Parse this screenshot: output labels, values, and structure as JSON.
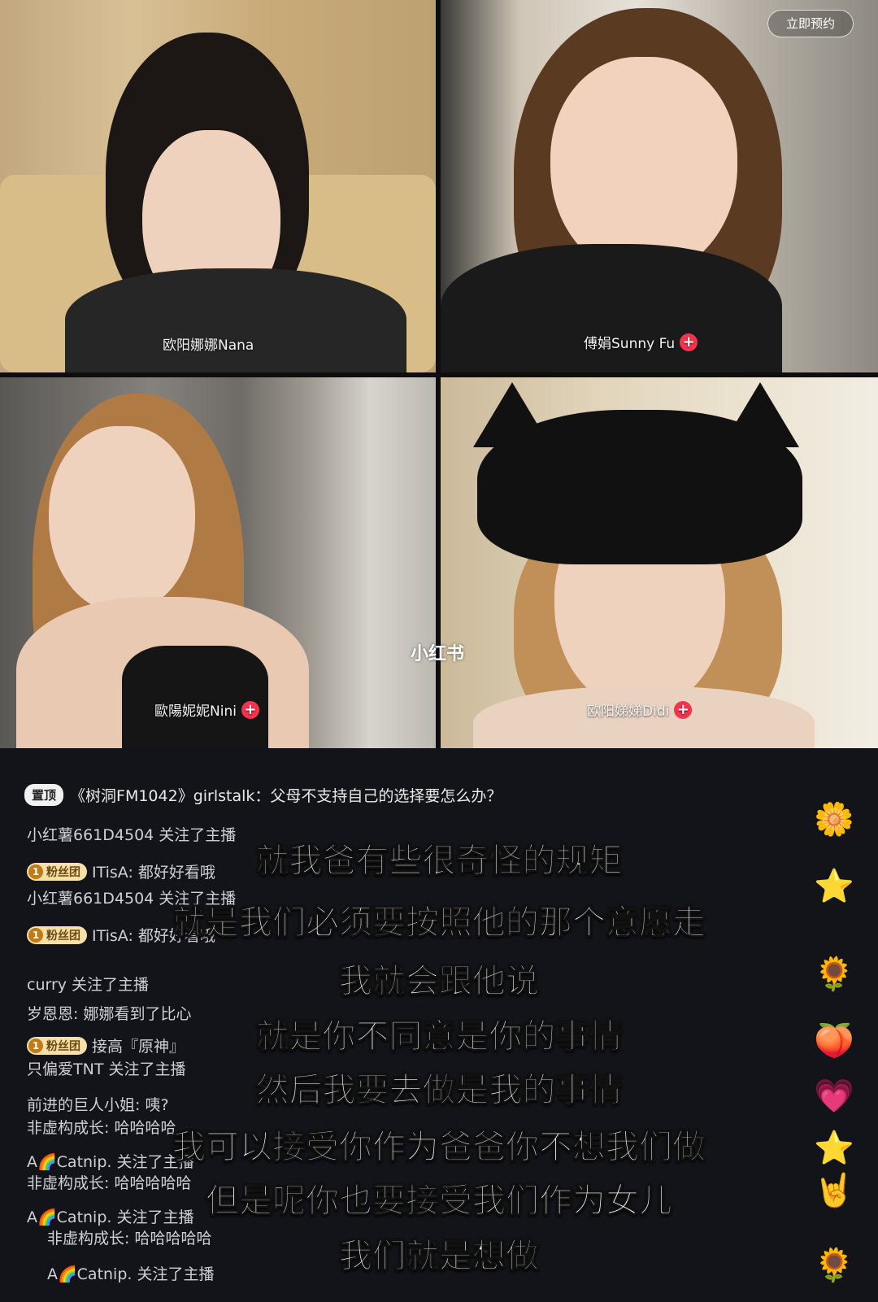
{
  "video_grid": {
    "reserve_button": "立即预约",
    "watermark": "小红书",
    "participants": [
      {
        "name": "欧阳娜娜Nana",
        "has_plus": false
      },
      {
        "name": "傅娟Sunny Fu",
        "has_plus": true
      },
      {
        "name": "歐陽妮妮Nini",
        "has_plus": true
      },
      {
        "name": "欧阳娣娣Didi",
        "has_plus": true
      }
    ]
  },
  "chat": {
    "pinned": {
      "tag": "置顶",
      "text": "《树洞FM1042》girlstalk：父母不支持自己的选择要怎么办？"
    },
    "messages": [
      {
        "text": "小红薯661D4504 关注了主播"
      },
      {
        "badge": "粉丝团",
        "badge_level": "1",
        "text": "ITisA: 都好好看哦"
      },
      {
        "text": "小红薯661D4504 关注了主播"
      },
      {
        "badge": "粉丝团",
        "badge_level": "1",
        "text": "ITisA: 都好好看哦"
      },
      {
        "text": "curry 关注了主播"
      },
      {
        "text": "岁恩恩: 娜娜看到了比心"
      },
      {
        "badge": "粉丝团",
        "badge_level": "1",
        "text": "接高『原神』"
      },
      {
        "text": "只偏爱TNT 关注了主播"
      },
      {
        "text": "前进的巨人小姐: 咦?"
      },
      {
        "text": "非虚构成长: 哈哈哈哈"
      },
      {
        "text": "A🌈Catnip. 关注了主播"
      },
      {
        "text": "非虚构成长: 哈哈哈哈哈"
      },
      {
        "text": "A🌈Catnip. 关注了主播"
      },
      {
        "text": "非虚构成长: 哈哈哈哈哈"
      },
      {
        "text": "A🌈Catnip. 关注了主播"
      }
    ],
    "subtitles": [
      "就我爸有些很奇怪的规矩",
      "就是我们必须要按照他的那个意愿走",
      "我就会跟他说",
      "就是你不同意是你的事情",
      "然后我要去做是我的事情",
      "我可以接受你作为爸爸你不想我们做",
      "但是呢你也要接受我们作为女儿",
      "我们就是想做"
    ],
    "reaction_icons": [
      "flower-icon",
      "star-icon",
      "sunflower-icon",
      "peach-icon",
      "heart-icon",
      "star-icon",
      "rock-hand-icon",
      "sunflower-icon"
    ],
    "reaction_glyphs": [
      "🌼",
      "⭐",
      "🌻",
      "🍑",
      "💗",
      "⭐",
      "🤘",
      "🌻"
    ]
  },
  "colors": {
    "plus_badge": "#f4334d",
    "fan_badge": "#f6dfa8",
    "background": "#131419"
  }
}
